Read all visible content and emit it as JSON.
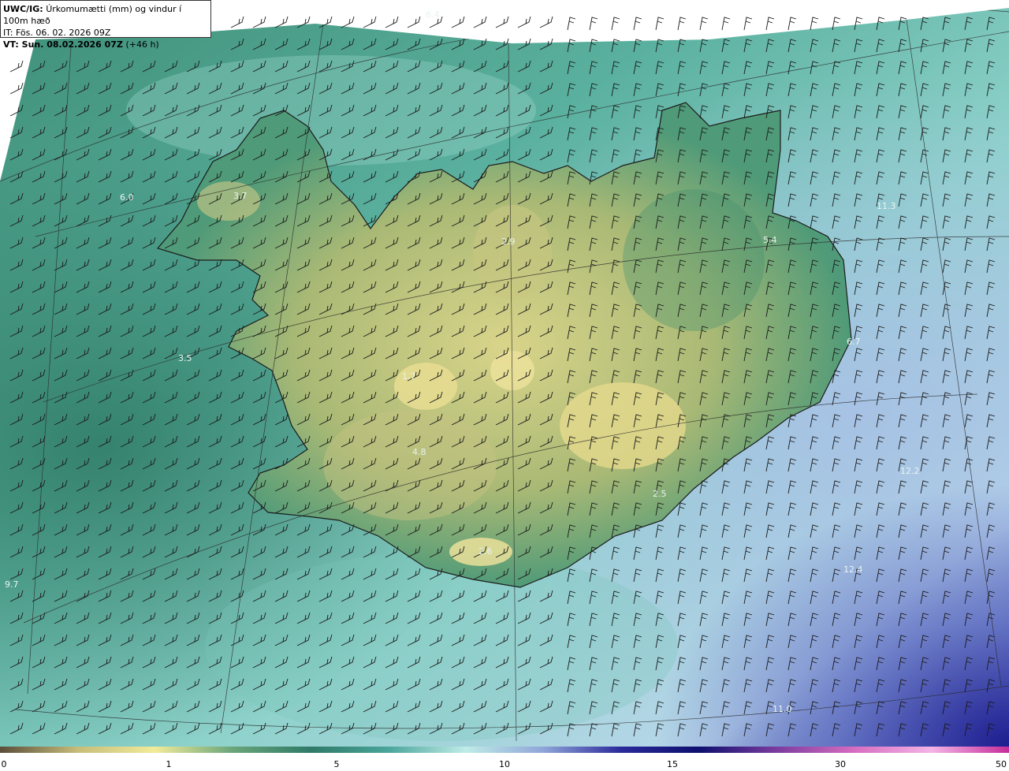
{
  "header": {
    "product": "UWC/IG:",
    "description": "Úrkomumætti (mm) og vindur í 100m hæð",
    "initial_time": "IT: Fös. 06. 02. 2026 09Z",
    "valid_prefix": "VT: Sun. 08.02.2026 07Z",
    "valid_suffix": "(+46 h)"
  },
  "map_values": [
    {
      "id": "v1",
      "text": "6.4"
    },
    {
      "id": "v2",
      "text": "3.7"
    },
    {
      "id": "v3",
      "text": "6.0"
    },
    {
      "id": "v4",
      "text": "2.9"
    },
    {
      "id": "v5",
      "text": "5.4"
    },
    {
      "id": "v6",
      "text": "11.3"
    },
    {
      "id": "v7",
      "text": "3.5"
    },
    {
      "id": "v8",
      "text": "1.7"
    },
    {
      "id": "v9",
      "text": "4.8"
    },
    {
      "id": "v10",
      "text": "2.5"
    },
    {
      "id": "v11",
      "text": "12.2"
    },
    {
      "id": "v12",
      "text": "2.6"
    },
    {
      "id": "v13",
      "text": "12.4"
    },
    {
      "id": "v14",
      "text": "6.7"
    },
    {
      "id": "v15",
      "text": "11.0"
    },
    {
      "id": "v16",
      "text": "9.7"
    }
  ],
  "colorbar": {
    "labels": [
      "0",
      "1",
      "5",
      "10",
      "15",
      "30",
      "50"
    ],
    "colors": [
      "#5a4d3a",
      "#c6bd7a",
      "#f1eb9a",
      "#6aa57a",
      "#2f7a68",
      "#4aa59a",
      "#bfece8",
      "#8fa5d8",
      "#2b2a9a",
      "#0d0f6e",
      "#7a3c9e",
      "#d66cc0",
      "#f3b4e6",
      "#c52c9a"
    ]
  }
}
